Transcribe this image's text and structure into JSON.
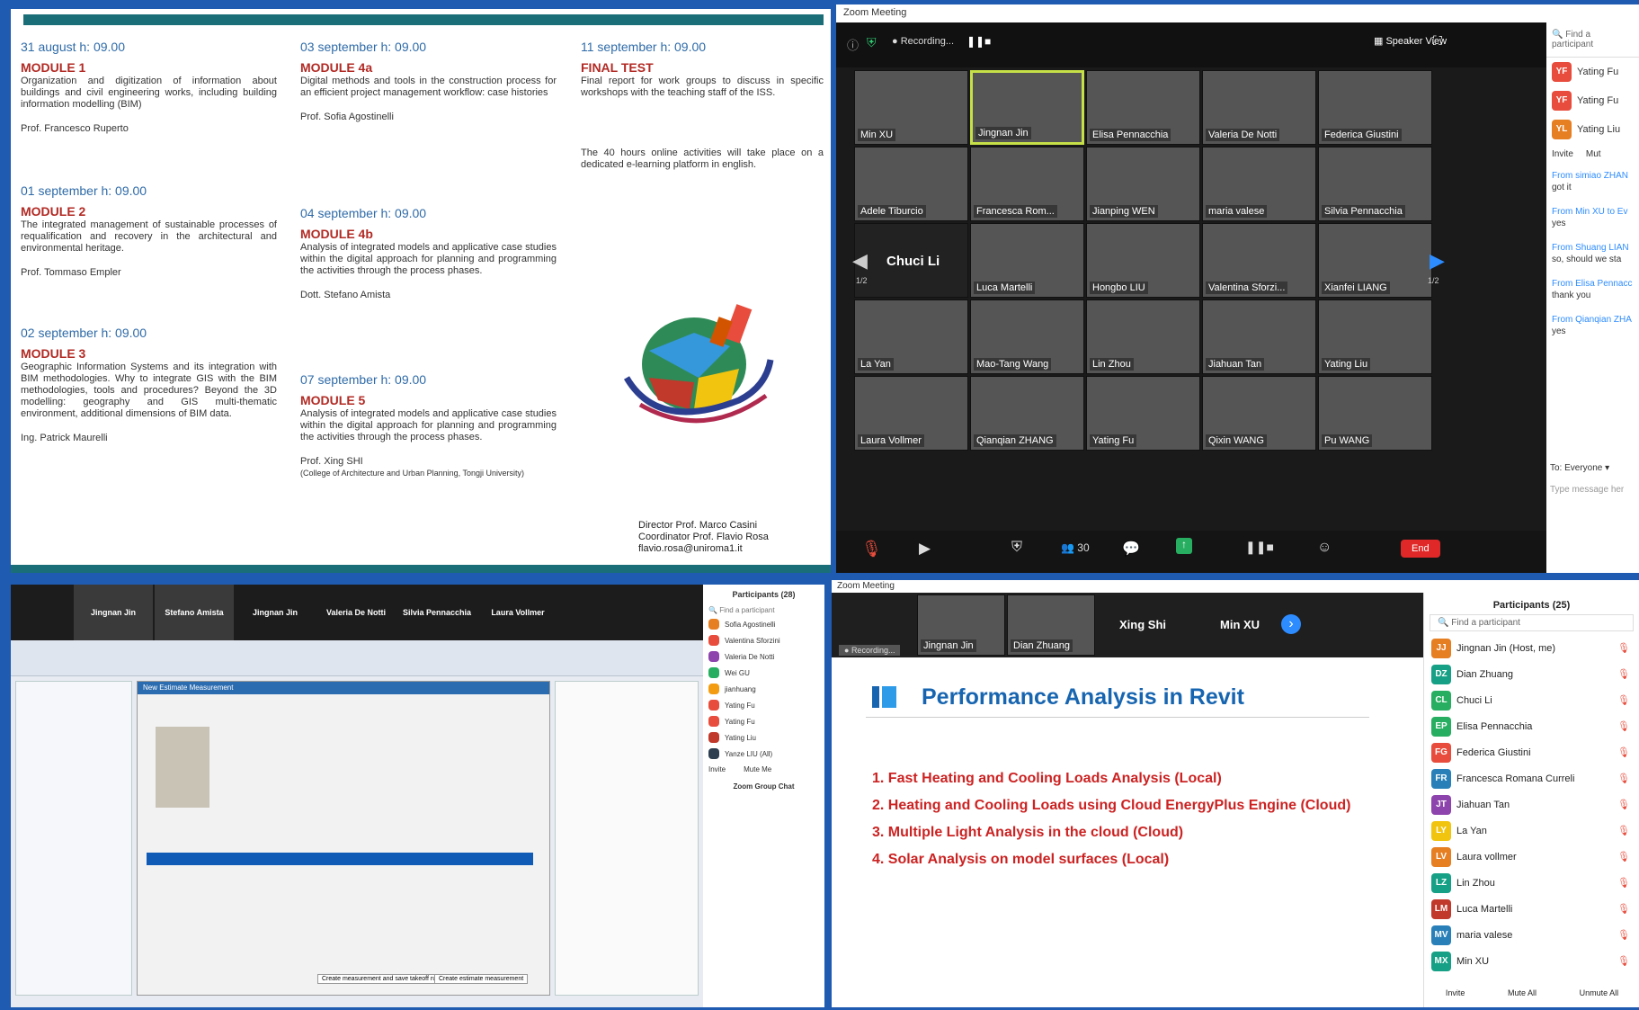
{
  "flyer": {
    "col1": [
      {
        "date": "31 august h: 09.00",
        "module": "MODULE 1",
        "desc": "Organization and digitization of information about buildings and civil engineering works, including building information modelling (BIM)",
        "prof": "Prof. Francesco Ruperto"
      },
      {
        "date": "01 september h: 09.00",
        "module": "MODULE 2",
        "desc": "The integrated management of sustainable processes of requalification and recovery in the architectural and environmental heritage.",
        "prof": "Prof. Tommaso Empler"
      },
      {
        "date": "02 september h: 09.00",
        "module": "MODULE 3",
        "desc": "Geographic Information Systems and its integration with BIM methodologies. Why to integrate GIS with the BIM methodologies, tools and procedures? Beyond the 3D modelling: geography and GIS multi-thematic environment, additional dimensions of BIM data.",
        "prof": "Ing. Patrick Maurelli"
      }
    ],
    "col2": [
      {
        "date": "03 september h: 09.00",
        "module": "MODULE 4a",
        "desc": "Digital methods and tools in the construction process for an efficient project management workflow: case histories",
        "prof": "Prof. Sofia Agostinelli"
      },
      {
        "date": "04 september h: 09.00",
        "module": "MODULE 4b",
        "desc": "Analysis of integrated models and applicative case studies within the digital approach for planning and programming the activities through the process phases.",
        "prof": "Dott. Stefano Amista"
      },
      {
        "date": "07 september h: 09.00",
        "module": "MODULE 5",
        "desc": "Analysis of integrated models and applicative case studies within the digital approach for planning and programming the activities through the process phases.",
        "prof": "Prof. Xing SHI",
        "prof_sub": "(College of Architecture and Urban Planning, Tongji University)"
      }
    ],
    "col3": {
      "date": "11 september h: 09.00",
      "module": "FINAL TEST",
      "desc": "Final report for work groups to discuss in specific workshops with the teaching staff of the ISS.",
      "note": "The 40 hours online activities will take place on a dedicated e-learning platform in english."
    },
    "signature": [
      "Director Prof. Marco Casini",
      "Coordinator Prof. Flavio Rosa",
      "flavio.rosa@uniroma1.it"
    ]
  },
  "zoom": {
    "title": "Zoom Meeting",
    "recording": "Recording...",
    "view": "Speaker View",
    "tiles": [
      "Min XU",
      "Jingnan Jin",
      "Elisa Pennacchia",
      "Valeria De Notti",
      "Federica Giustini",
      "Adele Tiburcio",
      "Francesca Rom...",
      "Jianping WEN",
      "maria valese",
      "Silvia Pennacchia",
      "Chuci Li",
      "Luca Martelli",
      "Hongbo LIU",
      "Valentina Sforzi...",
      "Xianfei LIANG",
      "La Yan",
      "Mao-Tang Wang",
      "Lin Zhou",
      "Jiahuan Tan",
      "Yating Liu",
      "Laura Vollmer",
      "Qianqian ZHANG",
      "Yating Fu",
      "Qixin WANG",
      "Pu WANG"
    ],
    "page": "1/2",
    "participants_count": "30",
    "end": "End",
    "side": {
      "search": "Find a participant",
      "people": [
        {
          "ini": "YF",
          "name": "Yating Fu"
        },
        {
          "ini": "YF",
          "name": "Yating Fu"
        },
        {
          "ini": "YL",
          "name": "Yating Liu"
        }
      ],
      "invite": "Invite",
      "mute": "Mut",
      "chat": [
        {
          "from": "From simiao ZHAN",
          "msg": "got it"
        },
        {
          "from": "From Min XU to Ev",
          "msg": "yes"
        },
        {
          "from": "From Shuang LIAN",
          "msg": "so, should we sta"
        },
        {
          "from": "From Elisa Pennacc",
          "msg": "thank you"
        },
        {
          "from": "From Qianqian ZHA",
          "msg": "yes"
        }
      ],
      "to": "To:",
      "everyone": "Everyone",
      "type": "Type message her"
    }
  },
  "bim": {
    "tiles": [
      "Jingnan Jin",
      "Stefano Amista",
      "Jingnan Jin",
      "Valeria De Notti",
      "Silvia Pennacchia",
      "Laura Vollmer"
    ],
    "participants_title": "Participants (28)",
    "search": "Find a participant",
    "people": [
      "Sofia Agostinelli",
      "Valentina Sforzini",
      "Valeria De Notti",
      "Wei GU",
      "jianhuang",
      "Yating Fu",
      "Yating Fu",
      "Yating Liu",
      "Yanze LIU (All)"
    ],
    "invite": "Invite",
    "muteme": "Mute Me",
    "chat_title": "Zoom Group Chat",
    "dialog": "New Estimate Measurement",
    "create": "Create measurement and save takeoff rule",
    "create2": "Create estimate measurement"
  },
  "perf": {
    "title": "Zoom Meeting",
    "recording": "Recording...",
    "tiles": [
      "Jingnan Jin",
      "Dian Zhuang",
      "Xing Shi",
      "Min XU"
    ],
    "slide_title": "Performance Analysis in Revit",
    "items": [
      "1. Fast Heating and Cooling Loads Analysis (Local)",
      "2. Heating and Cooling Loads using Cloud EnergyPlus Engine (Cloud)",
      "3. Multiple Light Analysis in the cloud (Cloud)",
      "4. Solar Analysis on model surfaces (Local)"
    ],
    "participants_title": "Participants (25)",
    "search": "Find a participant",
    "people": [
      {
        "ini": "JJ",
        "name": "Jingnan Jin (Host, me)",
        "c": "#e67e22"
      },
      {
        "ini": "DZ",
        "name": "Dian Zhuang",
        "c": "#16a085"
      },
      {
        "ini": "CL",
        "name": "Chuci Li",
        "c": "#27ae60"
      },
      {
        "ini": "EP",
        "name": "Elisa Pennacchia",
        "c": "#27ae60"
      },
      {
        "ini": "FG",
        "name": "Federica Giustini",
        "c": "#e74c3c"
      },
      {
        "ini": "FR",
        "name": "Francesca Romana Curreli",
        "c": "#2980b9"
      },
      {
        "ini": "JT",
        "name": "Jiahuan Tan",
        "c": "#8e44ad"
      },
      {
        "ini": "LY",
        "name": "La Yan",
        "c": "#f1c40f"
      },
      {
        "ini": "LV",
        "name": "Laura vollmer",
        "c": "#e67e22"
      },
      {
        "ini": "LZ",
        "name": "Lin Zhou",
        "c": "#16a085"
      },
      {
        "ini": "LM",
        "name": "Luca Martelli",
        "c": "#c0392b"
      },
      {
        "ini": "MV",
        "name": "maria valese",
        "c": "#2980b9"
      },
      {
        "ini": "MX",
        "name": "Min XU",
        "c": "#16a085"
      }
    ],
    "invite": "Invite",
    "muteall": "Mute All",
    "unmuteall": "Unmute All"
  }
}
